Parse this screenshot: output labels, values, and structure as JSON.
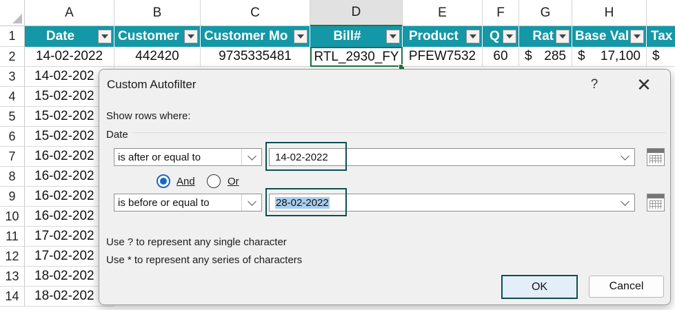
{
  "sheet": {
    "columns": [
      "A",
      "B",
      "C",
      "D",
      "E",
      "F",
      "G",
      "H",
      ""
    ],
    "selected_column": "D",
    "row_numbers": [
      "1",
      "2",
      "3",
      "4",
      "5",
      "6",
      "7",
      "8",
      "9",
      "10",
      "11",
      "12",
      "13",
      "14"
    ],
    "headers": [
      "Date",
      "Customer",
      "Customer Mo",
      "Bill#",
      "Product",
      "Q",
      "Rat",
      "Base Val",
      "Tax"
    ],
    "row2": {
      "date": "14-02-2022",
      "customer": "442420",
      "mobile": "9735335481",
      "bill": "RTL_2930_FY",
      "product": "PFEW7532",
      "qty": "60",
      "rate_symbol": "$",
      "rate": "285",
      "base_symbol": "$",
      "base": "17,100",
      "tax_symbol": "$"
    },
    "dates": [
      "14-02-202",
      "15-02-202",
      "15-02-202",
      "15-02-202",
      "16-02-202",
      "16-02-202",
      "16-02-202",
      "16-02-202",
      "17-02-202",
      "17-02-202",
      "18-02-202",
      "18-02-202"
    ]
  },
  "dialog": {
    "title": "Custom Autofilter",
    "help_label": "?",
    "close_label": "✕",
    "show_rows_label": "Show rows where:",
    "field_label": "Date",
    "criteria1": {
      "operator": "is after or equal to",
      "value": "14-02-2022"
    },
    "and_label": "And",
    "or_label": "Or",
    "logic_selected": "And",
    "criteria2": {
      "operator": "is before or equal to",
      "value": "28-02-2022"
    },
    "hint1": "Use ? to represent any single character",
    "hint2": "Use * to represent any series of characters",
    "ok_label": "OK",
    "cancel_label": "Cancel",
    "accent_color": "#0e4d4d",
    "radio_color": "#1a67c2"
  },
  "colors": {
    "header_fill": "#1497a6",
    "header_text": "#ffffff",
    "selection_green": "#217346"
  }
}
